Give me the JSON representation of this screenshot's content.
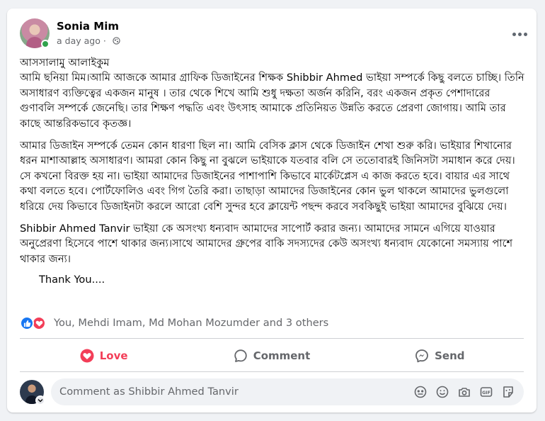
{
  "post": {
    "author": "Sonia Mim",
    "time": "a day ago ·",
    "paragraphs": [
      "আসসালামু আলাইকুম\nআমি ছনিয়া মিম।আমি আজকে আমার গ্রাফিক ডিজাইনের শিক্ষক Shibbir Ahmed ভাইয়া সম্পর্কে কিছু বলতে চাচ্ছি। তিনি অসাধারণ ব্যক্তিত্বের একজন মানুষ । তার থেকে শিখে আমি শুধু দক্ষতা অর্জন করিনি, বরং একজন প্রকৃত পেশাদারের গুণাবলি সম্পর্কে জেনেছি। তার শিক্ষণ পদ্ধতি এবং উৎসাহ আমাকে প্রতিনিয়ত উন্নতি করতে প্রেরণা জোগায়। আমি তার কাছে আন্তরিকভাবে কৃতজ্ঞ।",
      "আমার ডিজাইন সম্পর্কে তেমন কোন ধারণা ছিল না। আমি বেসিক ক্লাস থেকে  ডিজাইন শেখা শুরু করি। ভাইয়ার শিখানোর ধরন মাশাআল্লাহ অসাধারণ। আমরা কোন কিছু না বুঝলে ভাইয়াকে যতবার বলি সে ততোবারই জিনিসটা সমাধান করে দেয়। সে কখনো বিরক্ত হয় না। ভাইয়া আমাদের ডিজাইনের পাশাপাশি কিভাবে মার্কেটপ্লেস এ কাজ করতে হবে। বায়ার এর  সাথে  কথা বলতে হবে। পোর্টফোলিও এবং গিগ তৈরি করা। তাছাড়া আমাদের ডিজাইনের কোন ভুল থাকলে আমাদের ভুলগুলো ধরিয়ে দেয় কিভাবে ডিজাইনটা করলে আরো বেশি সুন্দর হবে ক্লায়েন্ট  পছন্দ করবে সবকিছুই ভাইয়া আমাদের বুঝিয়ে দেয়।",
      "Shibbir Ahmed Tanvir ভাইয়া কে অসংখ্য ধন্যবাদ আমাদের সাপোর্ট করার জন্য। আমাদের সামনে এগিয়ে যাওয়ার অনুপ্রেরণা  হিসেবে পাশে থাকার জন্য।সাথে আমাদের গ্রুপের বাকি সদস্যদের কেউ অসংখ্য ধন্যবাদ যেকোনো  সমস্যায় পাশে থাকার জন্য।"
    ],
    "closing": "Thank You...."
  },
  "reactions": {
    "summary": "You, Mehdi Imam, Md Mohan Mozumder and 3 others",
    "types": [
      "like-icon",
      "love-icon"
    ]
  },
  "actions": {
    "love": "Love",
    "comment": "Comment",
    "send": "Send"
  },
  "comment_box": {
    "placeholder": "Comment as Shibbir Ahmed Tanvir",
    "tools": [
      "avatar-sticker-icon",
      "emoji-icon",
      "camera-icon",
      "gif-icon",
      "sticker-icon"
    ]
  },
  "colors": {
    "love": "#f33e58",
    "like": "#1877f2",
    "muted": "#65676b",
    "online": "#31a24c"
  }
}
